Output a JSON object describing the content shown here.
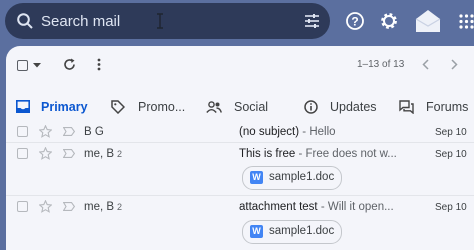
{
  "search": {
    "placeholder": "Search mail",
    "value": ""
  },
  "toolbar": {
    "range": "1–13 of 13"
  },
  "tabs": [
    {
      "label": "Primary",
      "active": true
    },
    {
      "label": "Promo..."
    },
    {
      "label": "Social"
    },
    {
      "label": "Updates"
    },
    {
      "label": "Forums"
    }
  ],
  "emails": [
    {
      "sender": "B G",
      "count": "",
      "subject": "(no subject)",
      "snippet": " - Hello",
      "date": "Sep 10"
    },
    {
      "sender": "me, B",
      "count": "2",
      "subject": "This is free",
      "snippet": " - Free does not w...",
      "date": "Sep 10",
      "attachment": "sample1.doc"
    },
    {
      "sender": "me, B",
      "count": "2",
      "subject": "attachment test",
      "snippet": " - Will it open...",
      "date": "Sep 10",
      "attachment": "sample1.doc"
    }
  ],
  "icons": [
    "search-icon",
    "filter-icon",
    "help-icon",
    "settings-icon",
    "email-app-icon",
    "apps-grid-icon",
    "checkbox-icon",
    "refresh-icon",
    "more-icon",
    "inbox-icon",
    "tag-icon",
    "people-icon",
    "info-icon",
    "forum-icon",
    "star-icon",
    "important-icon",
    "word-doc-icon"
  ],
  "colors": {
    "accent": "#0b57d0",
    "header_bg": "#5b6f9f",
    "search_bg": "#2e3a59"
  }
}
